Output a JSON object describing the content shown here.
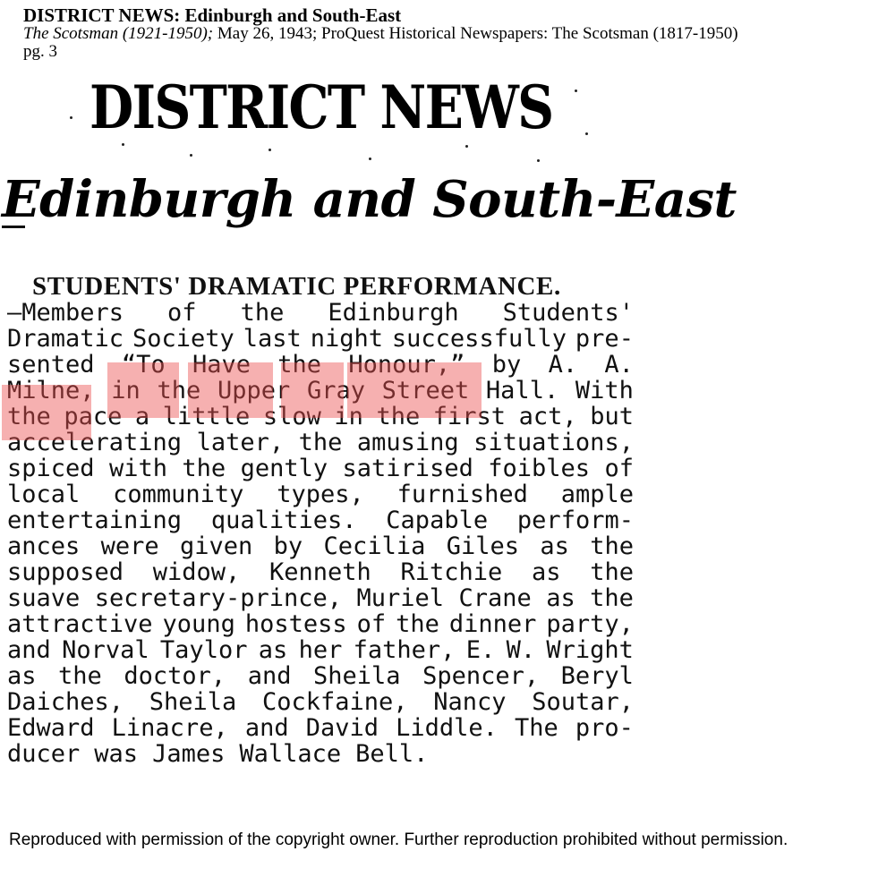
{
  "citation": {
    "title": "DISTRICT NEWS: Edinburgh and South-East",
    "source": "The Scotsman (1921-1950);",
    "details": "May 26, 1943; ProQuest Historical Newspapers: The Scotsman (1817-1950)",
    "page": "pg. 3"
  },
  "masthead": {
    "title": "DISTRICT NEWS",
    "subtitle": "Edinburgh and South-East"
  },
  "article": {
    "headline": "STUDENTS' DRAMATIC PERFORMANCE.",
    "lines": [
      [
        "—Members",
        "of",
        "the",
        "Edinburgh",
        "Students'"
      ],
      [
        "Dramatic",
        "Society",
        "last",
        "night",
        "successfully",
        "pre-"
      ],
      [
        "sented",
        "“To",
        "Have",
        "the",
        "Honour,”",
        "by",
        "A.",
        "A."
      ],
      [
        "Milne,",
        "in",
        "the",
        "Upper",
        "Gray",
        "Street",
        "Hall.",
        "With"
      ],
      [
        "the",
        "pace",
        "a",
        "little",
        "slow",
        "in",
        "the",
        "first",
        "act,",
        "but"
      ],
      [
        "accelerating",
        "later,",
        "the",
        "amusing",
        "situations,"
      ],
      [
        "spiced",
        "with",
        "the",
        "gently",
        "satirised",
        "foibles",
        "of"
      ],
      [
        "local",
        "community",
        "types,",
        "furnished",
        "ample"
      ],
      [
        "entertaining",
        "qualities.",
        "Capable",
        "perform-"
      ],
      [
        "ances",
        "were",
        "given",
        "by",
        "Cecilia",
        "Giles",
        "as",
        "the"
      ],
      [
        "supposed",
        "widow,",
        "Kenneth",
        "Ritchie",
        "as",
        "the"
      ],
      [
        "suave",
        "secretary-prince,",
        "Muriel",
        "Crane",
        "as",
        "the"
      ],
      [
        "attractive",
        "young",
        "hostess",
        "of",
        "the",
        "dinner",
        "party,"
      ],
      [
        "and",
        "Norval",
        "Taylor",
        "as",
        "her",
        "father,",
        "E.",
        "W.",
        "Wright"
      ],
      [
        "as",
        "the",
        "doctor,",
        "and",
        "Sheila",
        "Spencer,",
        "Beryl"
      ],
      [
        "Daiches,",
        "Sheila",
        "Cockfaine,",
        "Nancy",
        "Soutar,"
      ],
      [
        "Edward",
        "Linacre,",
        "and",
        "David",
        "Liddle.",
        "The",
        "pro-"
      ],
      [
        "ducer",
        "was",
        "James",
        "Wallace",
        "Bell."
      ]
    ]
  },
  "highlight_color": "#ec5050",
  "footer": "Reproduced with permission of the copyright owner.  Further reproduction prohibited without permission."
}
